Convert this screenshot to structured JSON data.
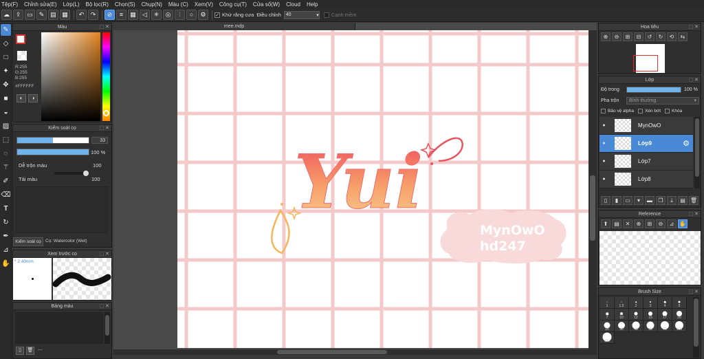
{
  "menu": [
    "Tệp(F)",
    "Chỉnh sửa(E)",
    "Lớp(L)",
    "Bộ lọc(R)",
    "Chọn(S)",
    "Chụp(N)",
    "Màu (C)",
    "Xem(V)",
    "Công cụ(T)",
    "Cửa sổ(W)",
    "Cloud",
    "Help"
  ],
  "toolbar": {
    "antialias_label": "Khử răng cưa",
    "adjust_label": "Điều chỉnh",
    "adjust_value": "40",
    "soft_edge_label": "Cạnh mềm"
  },
  "doc_tab": "mee.mdp",
  "color_panel": {
    "title": "Màu",
    "r": "R:255",
    "g": "G:255",
    "b": "B:255",
    "hex": "#FFFFFF"
  },
  "brush_control": {
    "title": "Kiểm soát cọ",
    "size_value": "33",
    "opacity_value": "100 %",
    "opacity_fraction": 1.0,
    "size_fraction": 0.5,
    "blend_label": "Dễ trộn màu",
    "blend_value": "100",
    "load_label": "Tải màu",
    "load_value": "100"
  },
  "brush_tabs": {
    "active": "Kiểm soát cọ",
    "current_brush": "Cọ: Watercolor (Wet)"
  },
  "brush_preview": {
    "title": "Xem trước cọ",
    "size_text": "* 2.40mm"
  },
  "palette": {
    "title": "Bảng màu",
    "footer_text": "---"
  },
  "navigator": {
    "title": "Hoa tiêu"
  },
  "layers": {
    "title": "Lớp",
    "opacity_label": "Độ trong",
    "opacity_value": "100 %",
    "opacity_fraction": 1.0,
    "blend_label": "Pha trộn",
    "blend_value": "Bình thường",
    "protect_alpha": "Bảo vệ alpha",
    "clipping": "Xén bớt",
    "lock": "Khóa",
    "items": [
      {
        "name": "MynOwO",
        "selected": false
      },
      {
        "name": "Lớp9",
        "selected": true
      },
      {
        "name": "Lớp7",
        "selected": false
      },
      {
        "name": "Lớp8",
        "selected": false
      }
    ]
  },
  "reference": {
    "title": "Reference"
  },
  "brush_size": {
    "title": "Brush Size",
    "sizes": [
      "1",
      "1.5",
      "2",
      "3",
      "4",
      "5",
      "7",
      "10",
      "12",
      "15",
      "17",
      "20",
      "25",
      "30",
      "40",
      "50",
      "70",
      "100",
      "150"
    ]
  },
  "artwork": {
    "title_text": "Yui",
    "watermark_line1": "MynOwO",
    "watermark_line2": "hd247"
  },
  "colors": {
    "accent": "#4a89d6",
    "grid": "#f4c9c9",
    "lettering_top": "#ef4f5c",
    "lettering_bottom": "#f6c882"
  }
}
